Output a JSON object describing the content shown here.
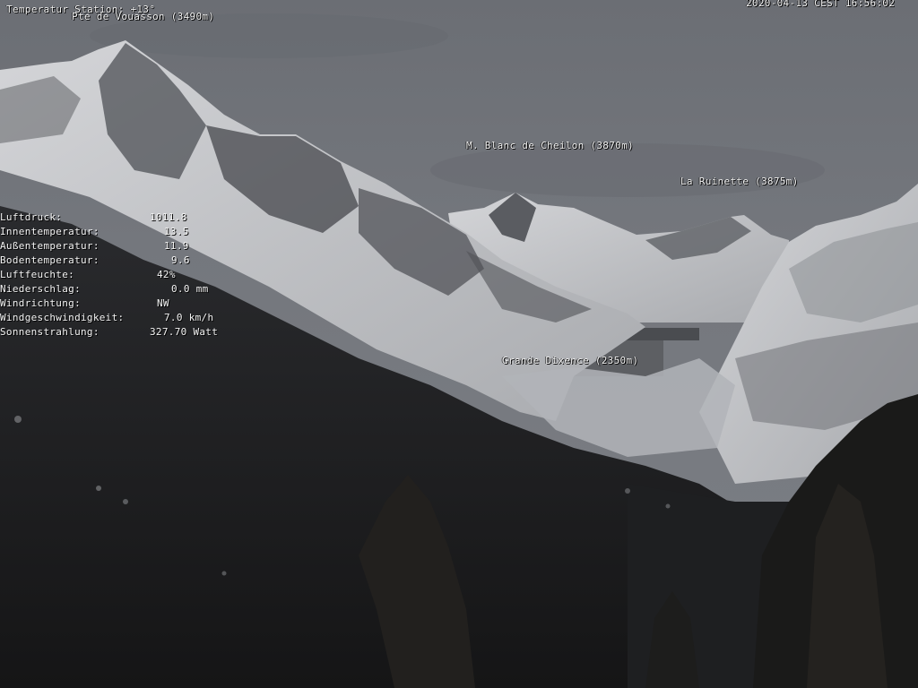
{
  "overlay": {
    "station_temperature": "Temperatur Station: +13°",
    "timestamp": "2020-04-13 CEST 16:56:02"
  },
  "peaks": {
    "vouasson": "Pte de Vouasson (3490m)",
    "blanc_de_cheilon": "M. Blanc de Cheilon (3870m)",
    "ruinette": "La Ruinette (3875m)",
    "grande_dixence": "Grande Dixence (2350m)"
  },
  "weather": {
    "luftdruck": {
      "label": "Luftdruck:",
      "value": "1011.8"
    },
    "innentemperatur": {
      "label": "Innentemperatur:",
      "value": "13.5"
    },
    "aussentemperatur": {
      "label": "Außentemperatur:",
      "value": "11.9"
    },
    "bodentemperatur": {
      "label": "Bodentemperatur:",
      "value": "9.6"
    },
    "luftfeuchte": {
      "label": "Luftfeuchte:",
      "value": "42%"
    },
    "niederschlag": {
      "label": "Niederschlag:",
      "value": "0.0 mm"
    },
    "windrichtung": {
      "label": "Windrichtung:",
      "value": "NW"
    },
    "windgeschwindigkeit": {
      "label": "Windgeschwindigkeit:",
      "value": "7.0 km/h"
    },
    "sonnenstrahlung": {
      "label": "Sonnenstrahlung:",
      "value": "327.70 Watt"
    }
  },
  "colors": {
    "sky": "#6f737a",
    "snow": "#c9cacd",
    "rock": "#3f4247",
    "forest": "#1c1c1e",
    "overlay_text": "#f4f4f4"
  }
}
